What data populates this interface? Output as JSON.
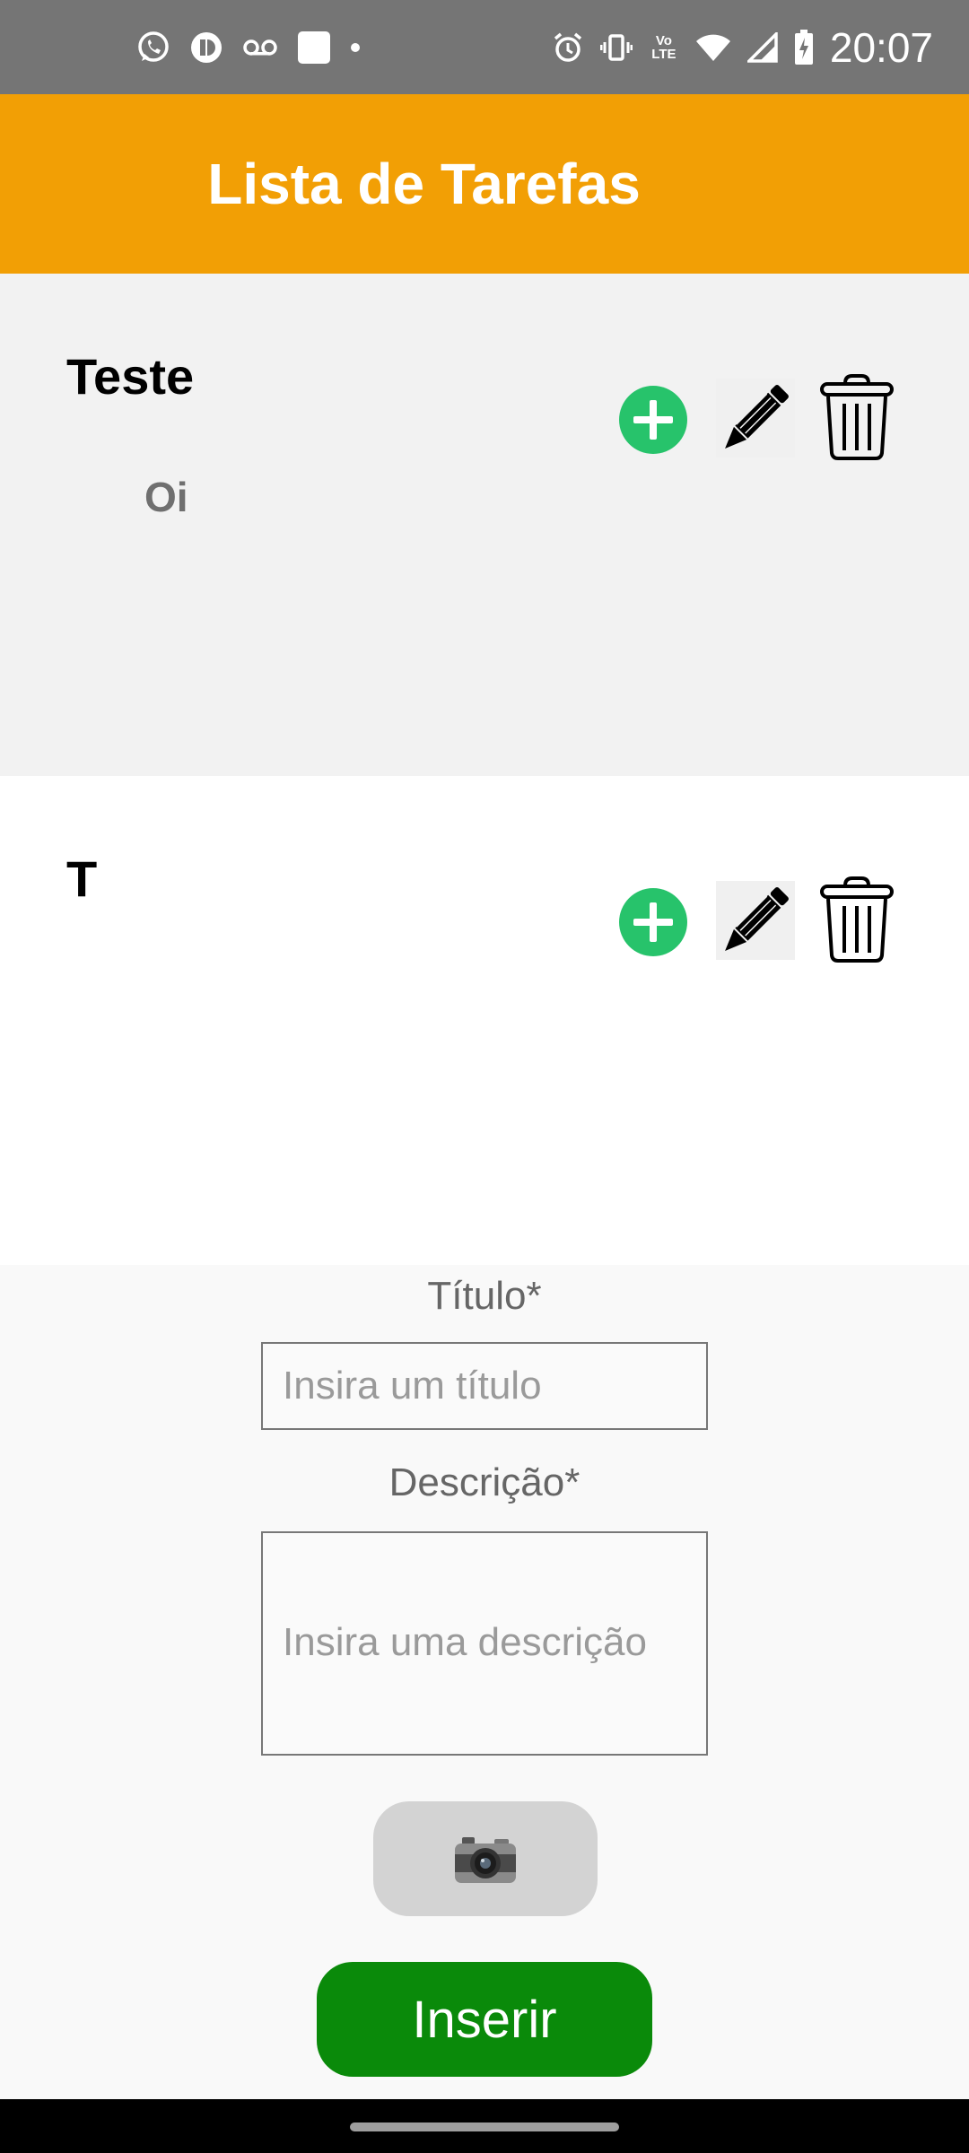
{
  "status_bar": {
    "time": "20:07",
    "notification_icons": [
      "whatsapp-icon",
      "app-icon",
      "voicemail-icon",
      "square-icon",
      "dot-icon"
    ],
    "system_icons": [
      "alarm-icon",
      "vibrate-icon",
      "volte-icon",
      "wifi-icon",
      "signal-icon",
      "battery-icon"
    ],
    "volte_label": "Vo LTE"
  },
  "header": {
    "title": "Lista de Tarefas",
    "background_color": "#f29f05"
  },
  "tasks": [
    {
      "title": "Teste",
      "description": "Oi"
    },
    {
      "title": "T",
      "description": ""
    }
  ],
  "task_action_icons": [
    "plus-icon",
    "pencil-icon",
    "trash-icon"
  ],
  "form": {
    "title_label": "Título*",
    "title_placeholder": "Insira um título",
    "title_value": "",
    "description_label": "Descrição*",
    "description_placeholder": "Insira uma descrição",
    "description_value": "",
    "camera_icon": "camera-icon",
    "submit_label": "Inserir",
    "submit_color": "#0a8a0a"
  }
}
